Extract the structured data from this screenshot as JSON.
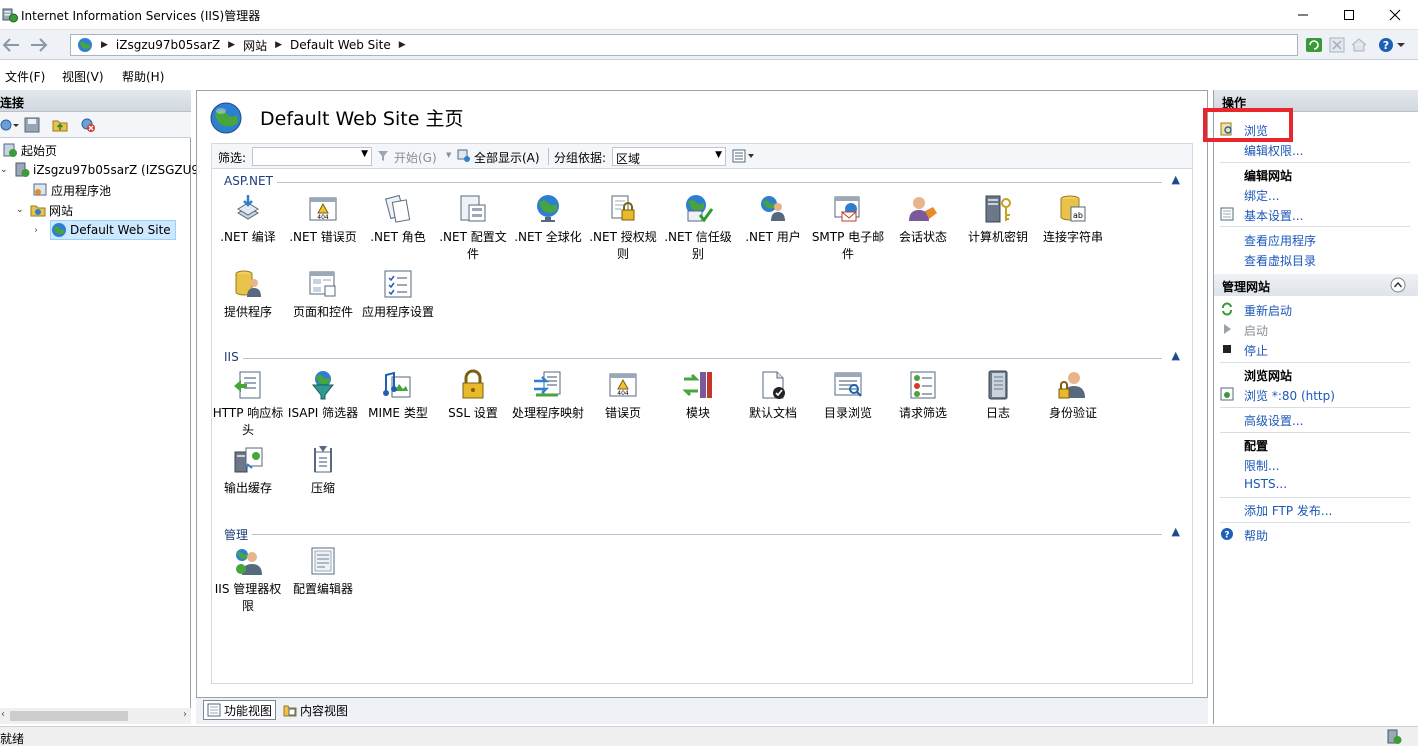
{
  "window": {
    "title": "Internet Information Services (IIS)管理器"
  },
  "address": {
    "crumbs": [
      "iZsgzu97b05sarZ",
      "网站",
      "Default Web Site"
    ]
  },
  "menu": [
    "文件(F)",
    "视图(V)",
    "帮助(H)"
  ],
  "connections": {
    "header": "连接",
    "tree": [
      {
        "label": "起始页",
        "icon": "start-page-icon"
      },
      {
        "label": "iZsgzu97b05sarZ (IZSGZU9",
        "icon": "server-icon"
      },
      {
        "label": "应用程序池",
        "icon": "app-pool-icon"
      },
      {
        "label": "网站",
        "icon": "sites-folder-icon"
      },
      {
        "label": "Default Web Site",
        "icon": "globe-icon"
      }
    ]
  },
  "center": {
    "title": "Default Web Site 主页",
    "filter": {
      "label": "筛选:",
      "go": "开始(G)",
      "show_all": "全部显示(A)",
      "group_by_label": "分组依据:",
      "group_by_value": "区域"
    },
    "groups": [
      {
        "name": "ASP.NET",
        "items": [
          ".NET 编译",
          ".NET 错误页",
          ".NET 角色",
          ".NET 配置文件",
          ".NET 全球化",
          ".NET 授权规则",
          ".NET 信任级别",
          ".NET 用户",
          "SMTP 电子邮件",
          "会话状态",
          "计算机密钥",
          "连接字符串",
          "提供程序",
          "页面和控件",
          "应用程序设置"
        ]
      },
      {
        "name": "IIS",
        "items": [
          "HTTP 响应标头",
          "ISAPI 筛选器",
          "MIME 类型",
          "SSL 设置",
          "处理程序映射",
          "错误页",
          "模块",
          "默认文档",
          "目录浏览",
          "请求筛选",
          "日志",
          "身份验证",
          "输出缓存",
          "压缩"
        ]
      },
      {
        "name": "管理",
        "items": [
          "IIS 管理器权限",
          "配置编辑器"
        ]
      }
    ],
    "view_tabs": [
      "功能视图",
      "内容视图"
    ]
  },
  "actions": {
    "header": "操作",
    "browse": "浏览",
    "edit_permissions": "编辑权限...",
    "edit_site_title": "编辑网站",
    "bindings": "绑定...",
    "basic_settings": "基本设置...",
    "view_apps": "查看应用程序",
    "view_vdirs": "查看虚拟目录",
    "manage_site_title": "管理网站",
    "restart": "重新启动",
    "start": "启动",
    "stop": "停止",
    "browse_site_title": "浏览网站",
    "browse_port": "浏览 *:80 (http)",
    "advanced": "高级设置...",
    "config_title": "配置",
    "limits": "限制...",
    "hsts": "HSTS...",
    "add_ftp": "添加 FTP 发布...",
    "help": "帮助"
  },
  "status": {
    "text": "就绪"
  },
  "colors": {
    "link": "#1c57b8",
    "group_header": "#1e3c78",
    "highlight": "#e8262c"
  }
}
